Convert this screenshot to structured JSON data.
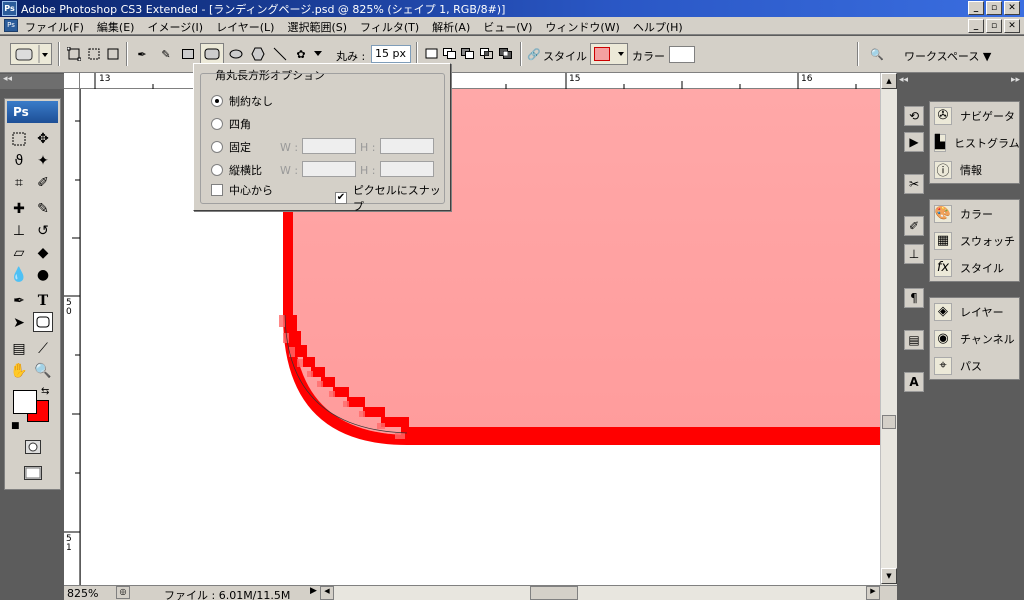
{
  "window": {
    "title": "Adobe Photoshop CS3 Extended - [ランディングページ.psd @ 825% (シェイプ 1, RGB/8#)]",
    "app_icon": "Ps"
  },
  "menu": {
    "items": [
      "ファイル(F)",
      "編集(E)",
      "イメージ(I)",
      "レイヤー(L)",
      "選択範囲(S)",
      "フィルタ(T)",
      "解析(A)",
      "ビュー(V)",
      "ウィンドウ(W)",
      "ヘルプ(H)"
    ]
  },
  "options": {
    "radius_label": "丸み :",
    "radius_value": "15 px",
    "style_label": "スタイル :",
    "color_label": "カラー :",
    "workspace_label": "ワークスペース ▼",
    "style_swatch_color": "#f4a0a0",
    "color_swatch_color": "#ffffff"
  },
  "popup": {
    "title": "角丸長方形オプション",
    "options": [
      "制約なし",
      "四角",
      "固定",
      "縦横比"
    ],
    "selected_index": 0,
    "w_label": "W :",
    "h_label": "H :",
    "from_center_label": "中心から",
    "from_center_checked": false,
    "snap_label": "ピクセルにスナップ",
    "snap_checked": true
  },
  "toolbox": {
    "header": "Ps",
    "foreground_color": "#ffffff",
    "background_color": "#ff0000"
  },
  "rulers": {
    "top_ticks": [
      "13",
      "15",
      "16"
    ],
    "left_ticks": [
      "5\n0",
      "5\n1"
    ]
  },
  "status": {
    "zoom": "825%",
    "file_info": "ファイル : 6.01M/11.5M"
  },
  "panels": {
    "group1": [
      "ナビゲータ",
      "ヒストグラム",
      "情報"
    ],
    "group2": [
      "カラー",
      "スウォッチ",
      "スタイル"
    ],
    "group3": [
      "レイヤー",
      "チャンネル",
      "パス"
    ]
  },
  "canvas": {
    "shape_fill": "#ffa6a6",
    "shape_stroke": "#ff0000"
  }
}
